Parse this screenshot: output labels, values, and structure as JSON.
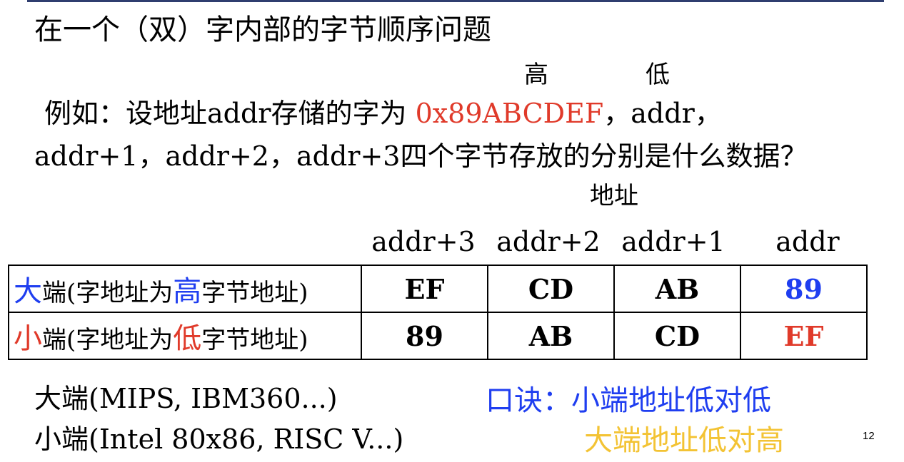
{
  "heading": "在一个（双）字内部的字节顺序问题",
  "byte_order_labels": {
    "high": "高",
    "low": "低"
  },
  "question": {
    "line1_prefix": "例如：设地址addr存储的字为",
    "word_value": "0x89ABCDEF",
    "line1_suffix": "，addr，",
    "line2": "addr+1，addr+2，addr+3四个字节存放的分别是什么数据？"
  },
  "address_label": "地址",
  "columns": [
    "addr+3",
    "addr+2",
    "addr+1",
    "addr"
  ],
  "rows": [
    {
      "first_char": "大",
      "label_mid": "端(字地址为",
      "keyword": "高",
      "label_end": "字节地址)",
      "values": [
        "EF",
        "CD",
        "AB",
        "89"
      ]
    },
    {
      "first_char": "小",
      "label_mid": "端(字地址为",
      "keyword": "低",
      "label_end": "字节地址)",
      "values": [
        "89",
        "AB",
        "CD",
        "EF"
      ]
    }
  ],
  "examples": {
    "big_endian": "大端(MIPS, IBM360...)",
    "little_endian": "小端(Intel 80x86, RISC V...)"
  },
  "mnemonic": {
    "line1": "口诀：小端地址低对低",
    "line2": "大端地址低对高"
  },
  "page_number": "12",
  "colors": {
    "red": "#e03a2a",
    "blue": "#1f3ef0",
    "yellow": "#f3c334",
    "rule": "#2f3e6f"
  }
}
